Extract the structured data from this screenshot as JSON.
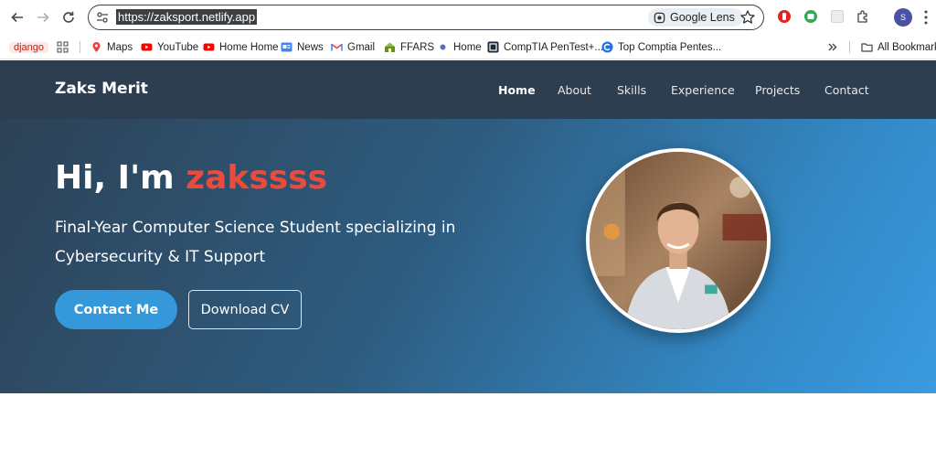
{
  "browser": {
    "url": "https://zaksport.netlify.app",
    "lens_label": "Google Lens",
    "profile_initial": "S",
    "bookmarks": [
      {
        "label": "django",
        "icon": "django-chip"
      },
      {
        "label": "Maps",
        "icon": "maps-icon"
      },
      {
        "label": "YouTube",
        "icon": "youtube-icon"
      },
      {
        "label": "Home Home",
        "icon": "youtube-icon"
      },
      {
        "label": "News",
        "icon": "news-icon"
      },
      {
        "label": "Gmail",
        "icon": "gmail-icon"
      },
      {
        "label": "FFARS",
        "icon": "ffars-icon"
      },
      {
        "label": "Home",
        "icon": "dot-icon"
      },
      {
        "label": "CompTIA PenTest+...",
        "icon": "comptia-icon"
      },
      {
        "label": "Top Comptia Pentes...",
        "icon": "c-icon"
      }
    ],
    "all_bookmarks_label": "All Bookmarks",
    "colors": {
      "youtube": "#ff0000",
      "gmail": "#ea4335",
      "ext_red": "#e52421",
      "ext_green": "#34a853",
      "profile": "#4a52a3"
    }
  },
  "site": {
    "brand": "Zaks Merit",
    "nav": [
      "Home",
      "About",
      "Skills",
      "Experience",
      "Projects",
      "Contact"
    ],
    "hero": {
      "greeting": "Hi, I'm ",
      "name": "zakssss",
      "subtitle": "Final-Year Computer Science Student specializing in Cybersecurity & IT Support",
      "primary_button": "Contact Me",
      "secondary_button": "Download CV"
    },
    "colors": {
      "header": "#2c3e50",
      "accent": "#e74c3c",
      "button": "#3498db"
    }
  }
}
